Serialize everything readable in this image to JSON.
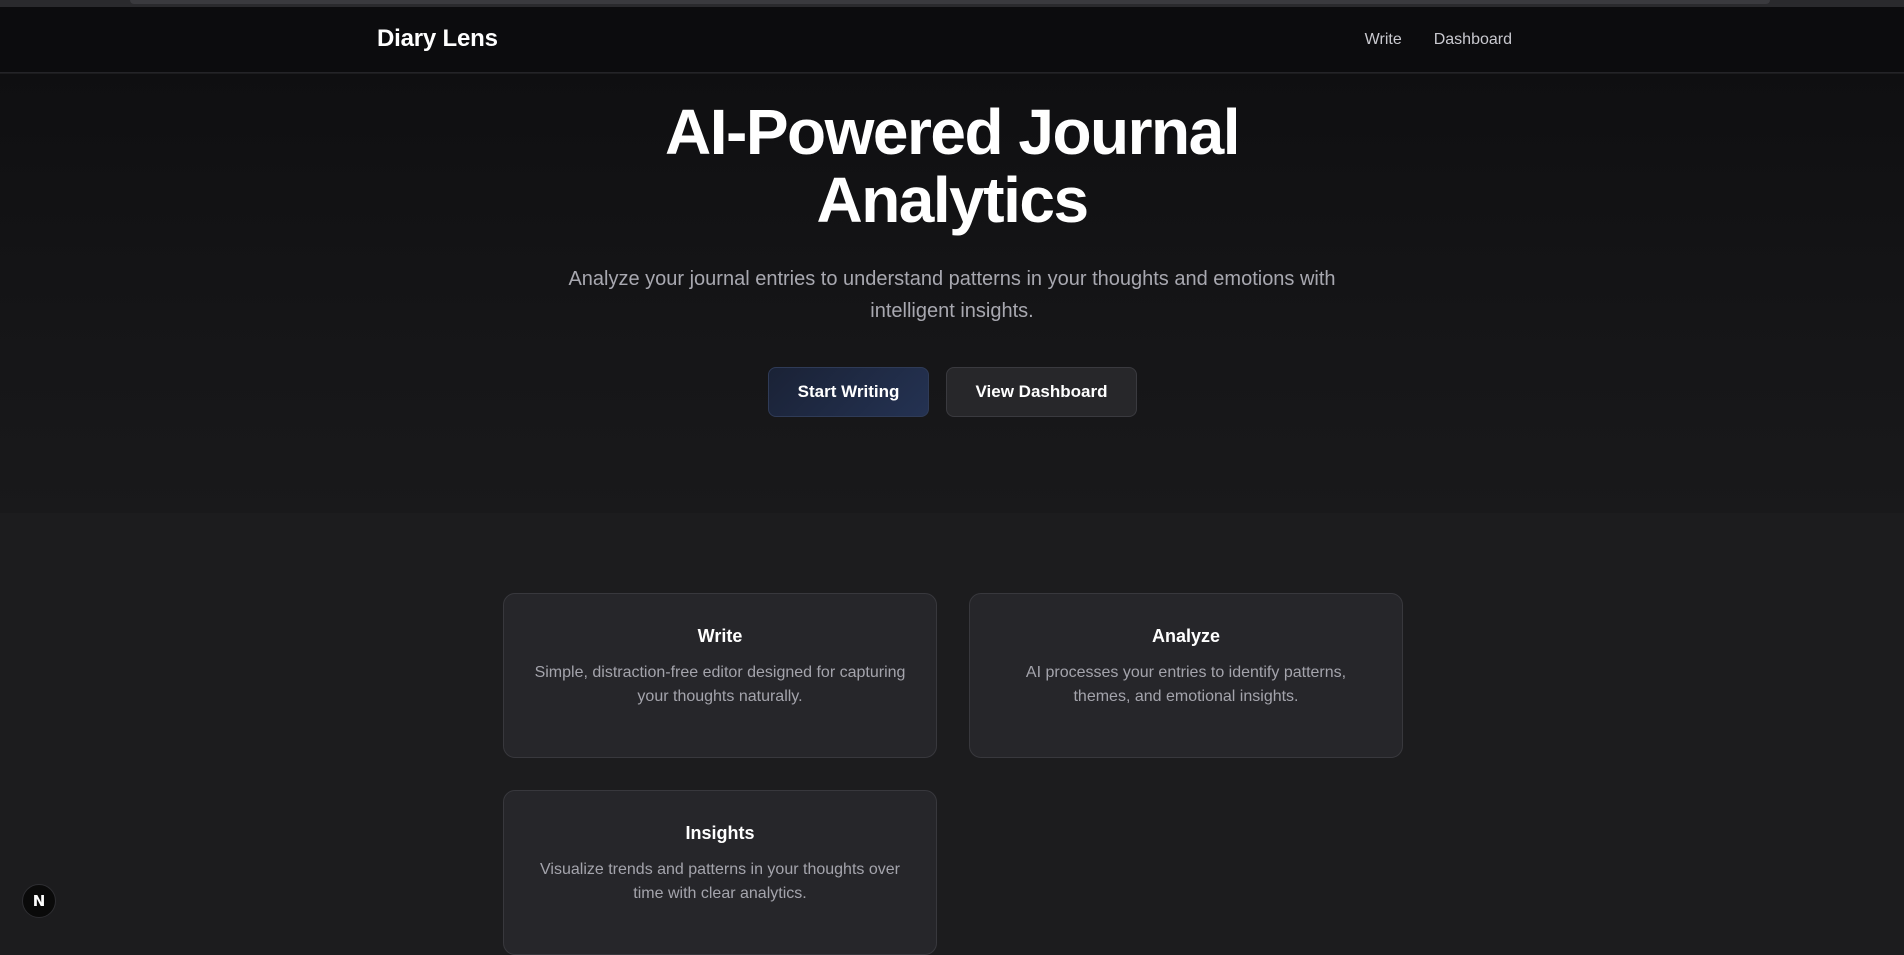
{
  "nav": {
    "brand": "Diary Lens",
    "links": [
      "Write",
      "Dashboard"
    ]
  },
  "hero": {
    "title_line1": "AI-Powered Journal",
    "title_line2": "Analytics",
    "subtitle": "Analyze your journal entries to understand patterns in your thoughts and emotions with intelligent insights.",
    "primary_button": "Start Writing",
    "secondary_button": "View Dashboard"
  },
  "features": [
    {
      "title": "Write",
      "description": "Simple, distraction-free editor designed for capturing your thoughts naturally."
    },
    {
      "title": "Analyze",
      "description": "AI processes your entries to identify patterns, themes, and emotional insights."
    },
    {
      "title": "Insights",
      "description": "Visualize trends and patterns in your thoughts over time with clear analytics."
    }
  ],
  "dev_badge": {
    "icon": "nextjs-icon",
    "glyph": "N"
  },
  "colors": {
    "background": "#1c1c1e",
    "nav_background": "#0c0c0e",
    "card_background": "#26262a",
    "primary_button": "#1f2a44",
    "secondary_button": "#27272a",
    "muted_text": "#a8a8b0"
  }
}
